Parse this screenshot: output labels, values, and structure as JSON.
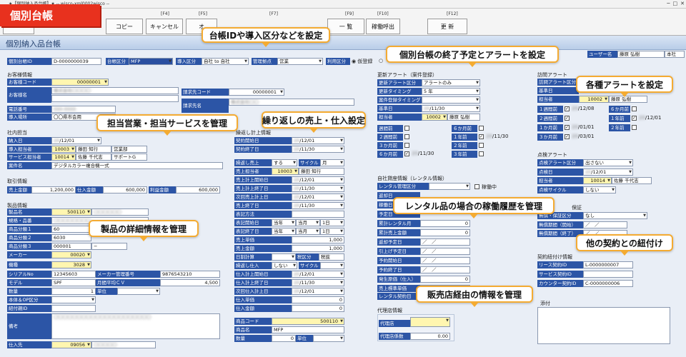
{
  "window": {
    "title": "★【個別納入品台帳】★ -- wisco-xml0002wisco --"
  },
  "brand": "個別台帳",
  "page_title": "個別納入品台帳",
  "fkeys": {
    "f4": "[F4]",
    "f5": "[F5]",
    "f7": "[F7]",
    "f9": "[F9]",
    "f10": "[F10]",
    "f12": "[F12]"
  },
  "buttons": {
    "copy": "コピー",
    "cancel": "キャンセル",
    "f5": "オ",
    "list": "一 覧",
    "history": "稼働呼出",
    "update": "更 新"
  },
  "callouts": {
    "c1": "台帳IDや導入区分などを設定",
    "c2": "個別台帳の終了予定とアラートを設定",
    "c3": "各種アラートを設定",
    "c4": "担当営業・担当サービスを管理",
    "c5": "繰り返しの売上・仕入設定",
    "c6": "レンタル品の場合の稼働履歴を管理",
    "c7": "製品の詳細情報を管理",
    "c8": "他の契約との紐付け",
    "c9": "販売店経由の情報を管理"
  },
  "header": {
    "ledger_id_label": "個別台帳ID",
    "ledger_id": "D-0000000039",
    "ledger_type_label": "台帳区分",
    "ledger_type": "MFP",
    "intro_label": "導入区分",
    "intro_value": "自社 to 自社",
    "mgmt_label": "管理拠点",
    "mgmt_value": "営業",
    "usage_label": "利用区分",
    "usage_value": "仮登録",
    "user_label": "ユーザー名",
    "user_name": "藤原 弘樹",
    "honsha": "本社"
  },
  "customer": {
    "section": "お客様情報",
    "code_label": "お客様コード",
    "code": "00000001",
    "name_label": "お客様名",
    "phone_label": "電話番号",
    "place_label": "導入場所",
    "place": "〇〇県市会用",
    "bill_code_label": "請求先コード",
    "bill_code": "00000001",
    "bill_name_label": "請求先名"
  },
  "staff": {
    "section": "社内担当",
    "intro_date_label": "納入日",
    "intro_date": "/12/01",
    "sales_label": "導入担当者",
    "sales_code": "10003",
    "sales_name": "藤田 知行",
    "sales_dept": "営業部",
    "service_label": "サービス担当者",
    "service_code": "10014",
    "service_name": "佐藤 千代志",
    "service_dept": "サポートG",
    "project_label": "案件名",
    "project": "デジタルカラー複合機一式"
  },
  "deal": {
    "section": "取引情報",
    "sales_label": "売上金額",
    "sales": "1,200,000",
    "cost_label": "仕入金額",
    "cost": "600,000",
    "profit_label": "利益金額",
    "profit": "600,000"
  },
  "product": {
    "section": "製品情報",
    "name_label": "製品名",
    "name_code": "500110",
    "spec_label": "規格・品番",
    "cat1_label": "商品分類１",
    "cat1": "60",
    "cat2_label": "商品分類２",
    "cat2": "6030",
    "cat3_label": "商品分類３",
    "cat3": "000001",
    "maker_label": "メーカー",
    "maker": "00020",
    "type_label": "機種",
    "type": "3028",
    "serial_label": "シリアルNo",
    "serial": "12345603",
    "maker_no_label": "メーカー管理番号",
    "maker_no": "9876543210",
    "model_label": "モデル",
    "model": "SPF",
    "monthly_label": "月間平均ＣＶ",
    "monthly": "4,500",
    "qty_label": "数量",
    "qty": "1",
    "unit_label": "単位",
    "body_label": "本体＆OP区分",
    "linked_label": "紐付親ID",
    "note_label": "備考",
    "vendor_label": "仕入先",
    "vendor": "09056"
  },
  "recurring": {
    "section": "繰返し計上情報",
    "contract_start_label": "契約開始日",
    "contract_start": "/12/01",
    "contract_end_label": "契約終了日",
    "contract_end": "/11/30",
    "renew_label": "繰返し売上",
    "renew_value": "する",
    "cycle_label": "サイクル",
    "cycle": "月",
    "sales_rep_label": "売上担当者",
    "sales_rep_code": "10003",
    "sales_rep": "藤田 知行",
    "sales_start_label": "売上計上開始日",
    "sales_start": "/12/01",
    "sales_end_label": "売上計上終了日",
    "sales_end": "/11/30",
    "next_sales_label": "次回売上計上日",
    "next_sales": "/12/01",
    "sales_end2_label": "売上終了日",
    "sales_end2": "/11/30",
    "method_label": "表記方法",
    "req_label": "表記開始日",
    "cur1": "当年",
    "cur2": "当月",
    "day1": "1日",
    "req_end_label": "表記終了日",
    "unit_price_label": "売上単価",
    "unit_price": "1,000",
    "amount_label": "売上金額",
    "amount": "1,000",
    "date_calc_label": "日割計算",
    "tax_label": "税区分",
    "tax": "税抜",
    "purchase_label": "繰返し仕入",
    "purchase_value": "しない",
    "cycle2_label": "サイクル",
    "p_start_label": "仕入計上開始日",
    "p_start": "/12/01",
    "p_end_label": "仕入計上終了日",
    "p_end": "/11/30",
    "p_next_label": "次回仕入計上日",
    "p_next": "/12/01",
    "p_price_label": "仕入単価",
    "p_price": "0",
    "p_amount_label": "仕入金額",
    "p_amount": "0",
    "item_code_label": "商品コード",
    "item_code": "500110",
    "item_name_label": "商品名",
    "item_name": "MFP",
    "qty2_label": "数量",
    "qty2": "0",
    "unit2_label": "単位"
  },
  "renewal": {
    "section": "更新アラート（案件登録）",
    "alert_label": "更新アラート区分",
    "alert": "アラートのみ",
    "timing_label": "更新タイミング",
    "timing": "5 年",
    "type_label": "案件登録タイミング",
    "base_label": "基準日",
    "base": "/11/30",
    "owner_label": "担当者",
    "owner_code": "10002",
    "owner": "藤原 弘樹",
    "r1": "週間前",
    "r2": "２週間前",
    "r3": "３か月前",
    "r4": "６か月前",
    "r5": "１年前",
    "r6": "２年前",
    "r7": "３年前",
    "d1": "/11/30",
    "d2": "/11/30",
    "d3": "/11/30"
  },
  "visit": {
    "section": "訪問アラート",
    "alert_label": "訪問アラート区分",
    "base_label": "基準日",
    "owner_label": "担当者",
    "owner_code": "10002",
    "owner": "藤原 弘樹",
    "w1": "１週間前",
    "w2": "２週間前",
    "m1": "１か月前",
    "m3": "３か月前",
    "m6": "６か月前",
    "y1": "１年前",
    "y2": "２年前",
    "d1": "/12/08",
    "d2": "/12/01",
    "d3": "/01/01",
    "d4": "/03/01"
  },
  "inspect": {
    "section": "点検アラート",
    "alert_label": "点検アラート区分",
    "alert": "出さない",
    "date_label": "点検日",
    "date": "/12/01",
    "owner_label": "担当者",
    "owner_code": "10014",
    "owner": "佐藤 千代志",
    "cycle_label": "点検サイクル",
    "cycle": "しない"
  },
  "warranty": {
    "section": "保証",
    "type_label": "無償・保証区分",
    "type": "なし",
    "period_label": "無償期間（開始）",
    "period_end_label": "無償期間（終了）",
    "dash": "／　／"
  },
  "rental": {
    "section": "自社貸座情報（レンタル情報）",
    "mgmt_label": "レンタル管理区分",
    "kept_label": "稼働中",
    "r1": "返却日",
    "r2": "稼働日",
    "r3": "予定日",
    "r4": "累計レンタル月",
    "r5": "累計売上金額",
    "r6": "返却予定日",
    "r7": "引上げ予定日",
    "r8": "予約開始日",
    "r9": "予約終了日",
    "r10": "発生原価（仕入）",
    "r11": "売上標準単価",
    "r12": "レンタル契約日",
    "zero": "0",
    "slash": "／　／"
  },
  "contract": {
    "section": "契約紐付け情報",
    "lease_label": "リース契約ID",
    "lease": "L-0000000007",
    "service_label": "サービス契約ID",
    "counter_label": "カウンター契約ID",
    "counter": "C-0000000006",
    "attach_label": "添付"
  },
  "agent": {
    "section": "代理店情報",
    "name_label": "代理店",
    "rate_label": "代理店係数",
    "rate": "0.00"
  }
}
